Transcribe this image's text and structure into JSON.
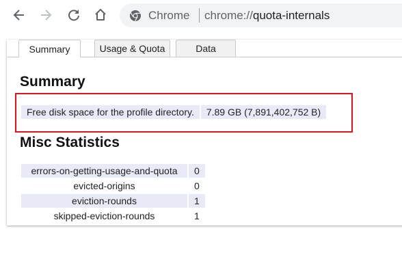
{
  "toolbar": {
    "omnibox_chip": "Chrome",
    "url_scheme": "chrome://",
    "url_host": "quota-internals"
  },
  "tabs": [
    {
      "label": "Summary",
      "active": true
    },
    {
      "label": "Usage & Quota",
      "active": false
    },
    {
      "label": "Data",
      "active": false
    }
  ],
  "summary": {
    "heading": "Summary",
    "free_disk_label": "Free disk space for the profile directory.",
    "free_disk_value": "7.89 GB (7,891,402,752 B)"
  },
  "misc": {
    "heading": "Misc Statistics",
    "rows": [
      {
        "name": "errors-on-getting-usage-and-quota",
        "value": "0"
      },
      {
        "name": "evicted-origins",
        "value": "0"
      },
      {
        "name": "eviction-rounds",
        "value": "1"
      },
      {
        "name": "skipped-eviction-rounds",
        "value": "1"
      }
    ]
  },
  "colors": {
    "highlight_border": "#e5111b",
    "row_shade": "#e9eaf7"
  }
}
